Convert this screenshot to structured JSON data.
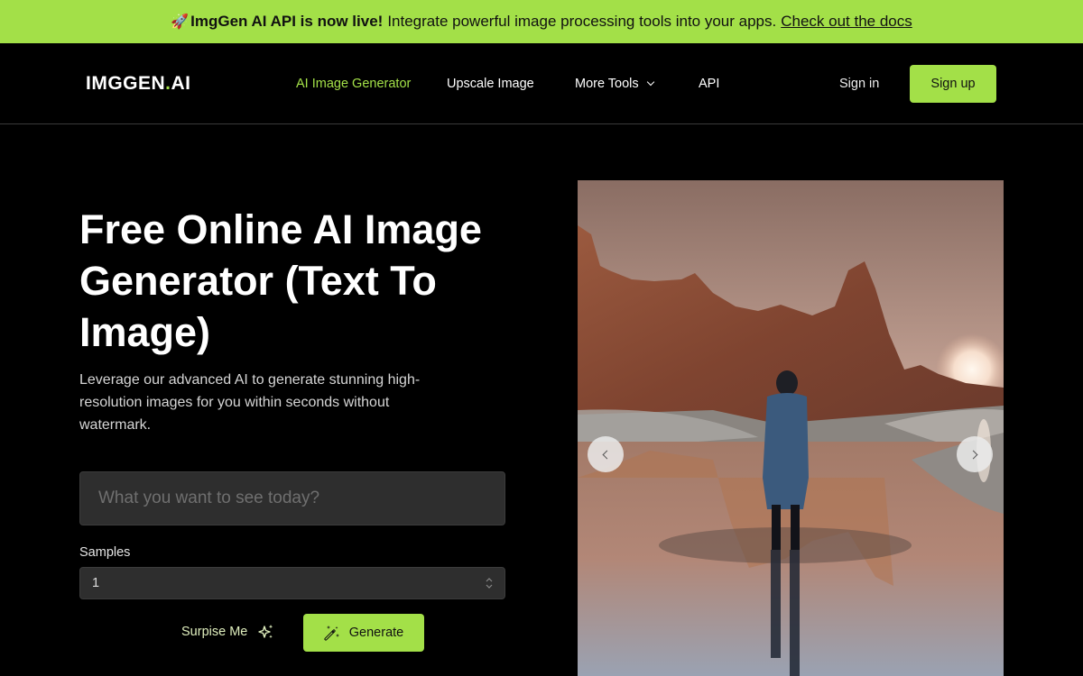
{
  "banner": {
    "icon": "rocket-icon",
    "emoji": "🚀",
    "headline": "ImgGen AI API is now live!",
    "text": "Integrate powerful image processing tools into your apps.",
    "link": "Check out the docs",
    "background": "#a3e048"
  },
  "nav": {
    "logo_main": "IMGGEN",
    "logo_dot": ".",
    "logo_suffix": "AI",
    "links": [
      {
        "label": "AI Image Generator",
        "active": true
      },
      {
        "label": "Upscale Image",
        "active": false
      },
      {
        "label": "More Tools",
        "active": false,
        "dropdown": true
      },
      {
        "label": "API",
        "active": false
      }
    ],
    "signin": "Sign in",
    "signup": "Sign up"
  },
  "hero": {
    "title": "Free Online AI Image Generator (Text To Image)",
    "subtitle": "Leverage our advanced AI to generate stunning high-resolution images for you within seconds without watermark.",
    "prompt_placeholder": "What you want to see today?",
    "prompt_value": "",
    "samples_label": "Samples",
    "samples_value": "1",
    "surprise_label": "Surpise Me",
    "generate_label": "Generate"
  },
  "carousel": {
    "image_description": "Person in blue coat standing in shallow water reflecting red desert cliffs at sunset",
    "prev_icon": "chevron-left-icon",
    "next_icon": "chevron-right-icon"
  },
  "colors": {
    "accent": "#a3e048",
    "background": "#000000",
    "input_bg": "#2e2e2e"
  }
}
